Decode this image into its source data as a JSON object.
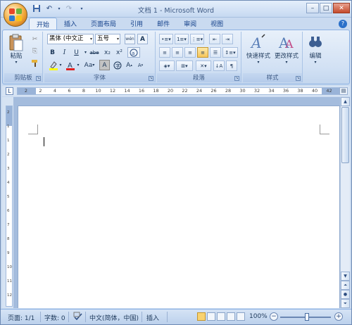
{
  "window": {
    "title": "文档 1 - Microsoft Word"
  },
  "tabs": [
    "开始",
    "插入",
    "页面布局",
    "引用",
    "邮件",
    "审阅",
    "视图"
  ],
  "ribbon": {
    "clipboard": {
      "label": "剪贴板",
      "paste": "粘贴"
    },
    "font": {
      "label": "字体",
      "font_name": "黑体 (中文正",
      "font_size": "五号",
      "bold": "B",
      "italic": "I",
      "underline": "U",
      "strike": "abe",
      "subscript": "x₂",
      "superscript": "x²",
      "change_case": "Aa",
      "grow": "A",
      "shrink": "A",
      "clear": "A",
      "wen": "wén",
      "char_border": "A"
    },
    "paragraph": {
      "label": "段落"
    },
    "styles": {
      "label": "样式",
      "quick_styles": "快速样式",
      "change_styles": "更改样式"
    },
    "editing": {
      "label": "编辑"
    }
  },
  "ruler": {
    "ticks": [
      "2",
      "2",
      "4",
      "6",
      "8",
      "10",
      "12",
      "14",
      "16",
      "18",
      "20",
      "22",
      "24",
      "26",
      "28",
      "30",
      "32",
      "34",
      "36",
      "38",
      "40",
      "42"
    ],
    "vticks": [
      "2",
      "1",
      "1",
      "2",
      "3",
      "4",
      "5",
      "6",
      "7",
      "8",
      "9",
      "10",
      "11",
      "12"
    ]
  },
  "status": {
    "page": "页面: 1/1",
    "words": "字数: 0",
    "language": "中文(简体，中国)",
    "mode": "插入",
    "zoom": "100%"
  },
  "colors": {
    "accent": "#15428b",
    "highlight": "#ffff00",
    "font_color": "#e02020"
  }
}
